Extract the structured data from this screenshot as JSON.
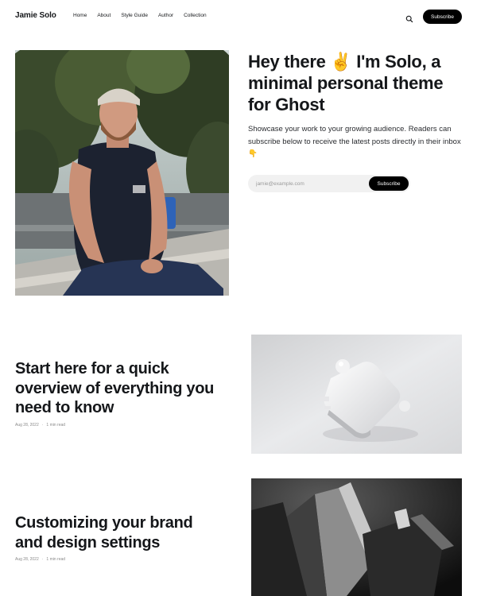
{
  "site": {
    "name": "Jamie Solo"
  },
  "nav": {
    "items": [
      "Home",
      "About",
      "Style Guide",
      "Author",
      "Collection"
    ]
  },
  "header": {
    "subscribe_label": "Subscribe"
  },
  "hero": {
    "title": "Hey there ✌️ I'm Solo, a minimal personal theme for Ghost",
    "description": "Showcase your work to your growing audience. Readers can subscribe below to receive the latest posts directly in their inbox 👇",
    "email_placeholder": "jamie@example.com",
    "subscribe_label": "Subscribe"
  },
  "posts": [
    {
      "title": "Start here for a quick overview of everything you need to know",
      "date": "Aug 28, 2022",
      "reading_time": "1 min read"
    },
    {
      "title": "Customizing your brand and design settings",
      "date": "Aug 28, 2022",
      "reading_time": "1 min read"
    }
  ],
  "icons": {
    "search": "search-icon"
  },
  "colors": {
    "accent": "#000000",
    "text": "#15171a",
    "muted": "#8a8a8a",
    "input_bg": "#f1f1f1"
  }
}
